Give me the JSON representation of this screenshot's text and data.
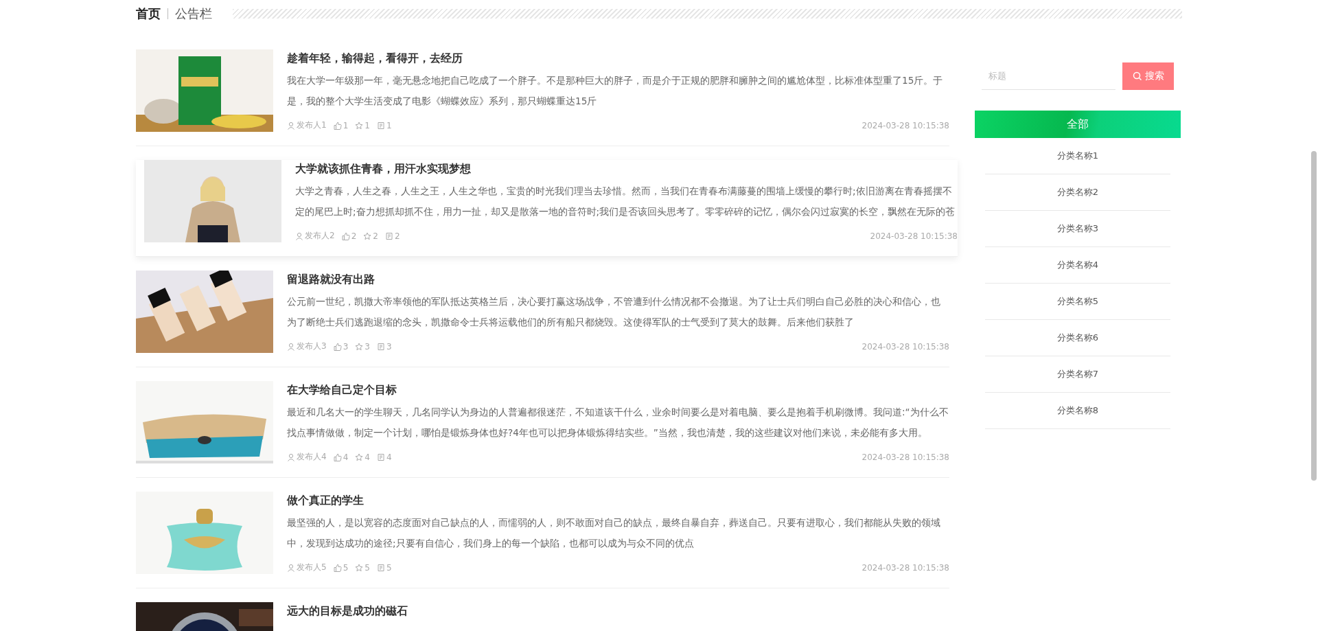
{
  "breadcrumb": [
    {
      "label": "首页",
      "selected": true
    },
    {
      "label": "公告栏",
      "selected": false
    }
  ],
  "articles": [
    {
      "title": "趁着年轻，输得起，看得开，去经历",
      "excerpt": "我在大学一年级那一年，毫无悬念地把自己吃成了一个胖子。不是那种巨大的胖子，而是介于正规的肥胖和臃肿之间的尴尬体型，比标准体型重了15斤。于是，我的整个大学生活变成了电影《蝴蝶效应》系列，那只蝴蝶重达15斤",
      "author": "发布人1",
      "likes": "1",
      "favorites": "1",
      "comments": "1",
      "time": "2024-03-28 10:15:38",
      "hovered": false
    },
    {
      "title": "大学就该抓住青春，用汗水实现梦想",
      "excerpt": "大学之青春，人生之春，人生之王，人生之华也，宝贵的时光我们理当去珍惜。然而，当我们在青春布满藤蔓的围墙上缓慢的攀行时;依旧游离在青春摇摆不定的尾巴上时;奋力想抓却抓不住，用力一扯，却又是散落一地的音符时;我们是否该回头思考了。零零碎碎的记忆，偶尔会闪过寂寞的长空，飘然在无际的苍",
      "author": "发布人2",
      "likes": "2",
      "favorites": "2",
      "comments": "2",
      "time": "2024-03-28 10:15:38",
      "hovered": true
    },
    {
      "title": "留退路就没有出路",
      "excerpt": "公元前一世纪，凯撒大帝率领他的军队抵达英格兰后，决心要打赢这场战争，不管遭到什么情况都不会撤退。为了让士兵们明白自己必胜的决心和信心，也为了断绝士兵们逃跑退缩的念头，凯撒命令士兵将运载他们的所有船只都烧毁。这使得军队的士气受到了莫大的鼓舞。后来他们获胜了",
      "author": "发布人3",
      "likes": "3",
      "favorites": "3",
      "comments": "3",
      "time": "2024-03-28 10:15:38",
      "hovered": false
    },
    {
      "title": "在大学给自己定个目标",
      "excerpt": "最近和几名大一的学生聊天，几名同学认为身边的人普遍都很迷茫，不知道该干什么，业余时间要么是对着电脑、要么是抱着手机刷微博。我问道:“为什么不找点事情做做，制定一个计划，哪怕是锻炼身体也好?4年也可以把身体锻炼得结实些。”当然，我也清楚，我的这些建议对他们来说，未必能有多大用。",
      "author": "发布人4",
      "likes": "4",
      "favorites": "4",
      "comments": "4",
      "time": "2024-03-28 10:15:38",
      "hovered": false
    },
    {
      "title": "做个真正的学生",
      "excerpt": "最坚强的人，是以宽容的态度面对自己缺点的人，而懦弱的人，则不敢面对自己的缺点，最终自暴自弃，葬送自己。只要有进取心，我们都能从失败的领域中，发现到达成功的途径;只要有自信心，我们身上的每一个缺陷，也都可以成为与众不同的优点",
      "author": "发布人5",
      "likes": "5",
      "favorites": "5",
      "comments": "5",
      "time": "2024-03-28 10:15:38",
      "hovered": false
    },
    {
      "title": "远大的目标是成功的磁石",
      "hovered": false
    }
  ],
  "search": {
    "placeholder": "标题",
    "button": "搜索"
  },
  "categories": [
    {
      "label": "全部",
      "selected": true
    },
    {
      "label": "分类名称1",
      "selected": false
    },
    {
      "label": "分类名称2",
      "selected": false
    },
    {
      "label": "分类名称3",
      "selected": false
    },
    {
      "label": "分类名称4",
      "selected": false
    },
    {
      "label": "分类名称5",
      "selected": false
    },
    {
      "label": "分类名称6",
      "selected": false
    },
    {
      "label": "分类名称7",
      "selected": false
    },
    {
      "label": "分类名称8",
      "selected": false
    }
  ]
}
